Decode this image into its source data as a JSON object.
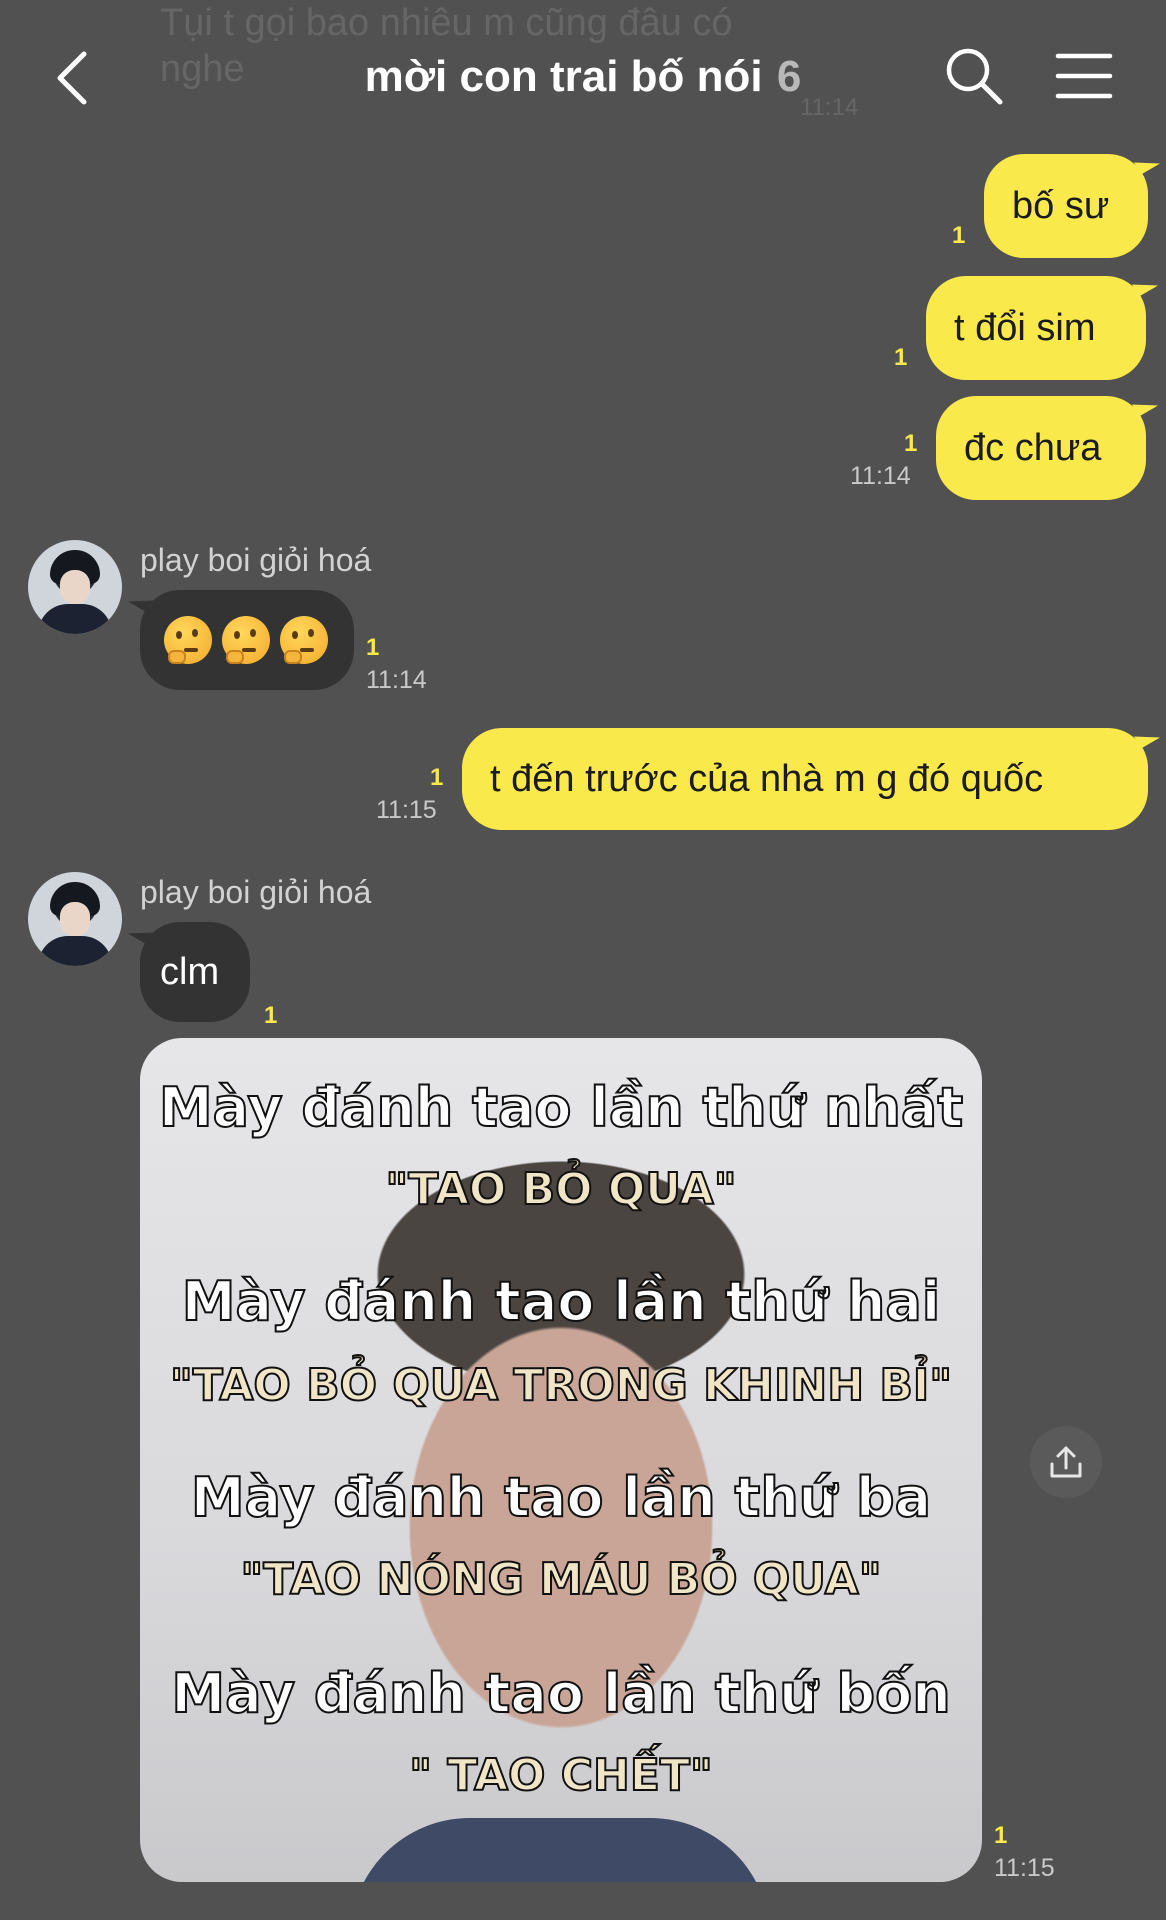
{
  "previous_message": {
    "text": "Tụi t gọi bao nhiêu m cũng đâu có nghe",
    "time": "11:14"
  },
  "header": {
    "title": "mời con trai bố nói",
    "member_count": "6",
    "back_icon": "chevron-left-icon",
    "search_icon": "search-icon",
    "menu_icon": "hamburger-menu-icon"
  },
  "messages": [
    {
      "from": "me",
      "text": "bố sư",
      "read": "1"
    },
    {
      "from": "me",
      "text": "t đổi sim",
      "read": "1"
    },
    {
      "from": "me",
      "text": "đc chưa",
      "read": "1",
      "time": "11:14"
    },
    {
      "from": "them",
      "sender": "play boi giỏi hoá",
      "text": "🤔🤔🤔",
      "read": "1",
      "time": "11:14"
    },
    {
      "from": "me",
      "text": "t đến trước của nhà m g đó quốc",
      "read": "1",
      "time": "11:15"
    },
    {
      "from": "them",
      "sender": "play boi giỏi hoá",
      "text": "clm",
      "read": "1"
    },
    {
      "from": "them",
      "type": "image",
      "read": "1",
      "time": "11:15",
      "image_text": [
        "Mày đánh tao lần thứ nhất",
        "\"TAO BỎ QUA\"",
        "Mày đánh tao lần thứ hai",
        "\"TAO BỎ QUA TRONG KHINH BỈ\"",
        "Mày đánh tao lần thứ ba",
        "\"TAO NÓNG MÁU BỎ QUA\"",
        "Mày đánh tao lần thứ bốn",
        "\" TAO CHẾT\""
      ]
    }
  ],
  "colors": {
    "background": "#525152",
    "my_bubble": "#fae94a",
    "their_bubble": "#333333",
    "read_count": "#fae94a"
  }
}
